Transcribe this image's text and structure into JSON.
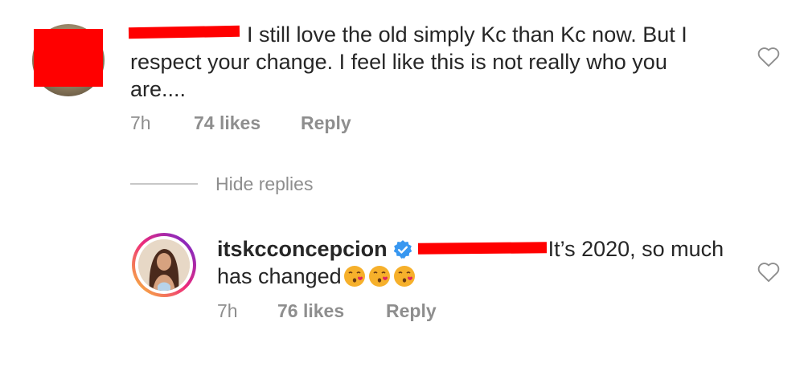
{
  "comment": {
    "redacted_username_color": "#ff0000",
    "text": "I still love the old simply Kc than Kc now. But I respect your change. I feel like this is not really who you are....",
    "time": "7h",
    "likes": "74 likes",
    "reply_label": "Reply"
  },
  "thread": {
    "hide_replies_label": "Hide replies"
  },
  "reply": {
    "username": "itskcconcepcion",
    "verified_icon": "verified-badge-icon",
    "text": "It’s 2020, so much has changed",
    "emojis": [
      "😘",
      "😘",
      "😘"
    ],
    "time": "7h",
    "likes": "76 likes",
    "reply_label": "Reply"
  },
  "colors": {
    "text": "#262626",
    "meta": "#8e8e8e",
    "verified": "#3897f0",
    "redaction": "#ff0000"
  }
}
